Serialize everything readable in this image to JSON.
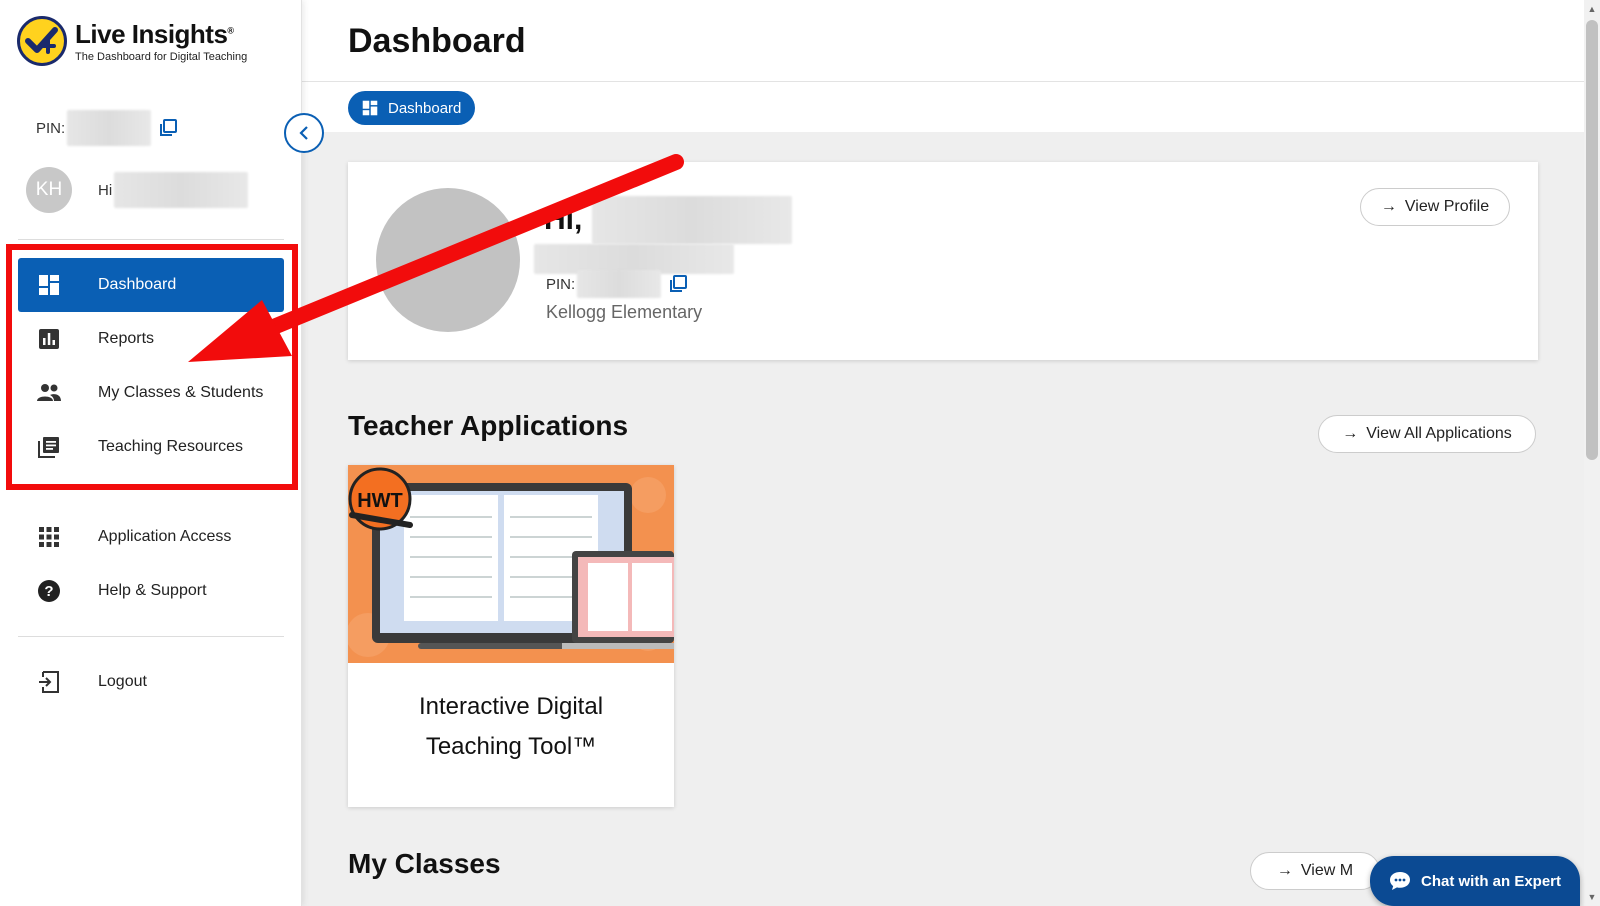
{
  "sidebar": {
    "logo_title": "Live Insights",
    "logo_reg": "®",
    "logo_subtitle": "The Dashboard for Digital Teaching",
    "pin_label": "PIN:",
    "avatar_initials": "KH",
    "greeting": "Hi",
    "nav": [
      {
        "label": "Dashboard",
        "icon": "dashboard-icon",
        "active": true
      },
      {
        "label": "Reports",
        "icon": "bar-chart-icon",
        "active": false
      },
      {
        "label": "My Classes & Students",
        "icon": "people-icon",
        "active": false
      },
      {
        "label": "Teaching Resources",
        "icon": "library-books-icon",
        "active": false
      },
      {
        "label": "Application Access",
        "icon": "apps-grid-icon",
        "active": false
      },
      {
        "label": "Help & Support",
        "icon": "help-icon",
        "active": false
      },
      {
        "label": "Logout",
        "icon": "logout-icon",
        "active": false
      }
    ]
  },
  "header": {
    "title": "Dashboard",
    "breadcrumb": "Dashboard"
  },
  "profile": {
    "greeting": "Hi,",
    "pin_label": "PIN:",
    "school": "Kellogg Elementary",
    "view_profile": "View Profile"
  },
  "teacher_apps": {
    "title": "Teacher Applications",
    "view_all": "View All Applications",
    "apps": [
      {
        "name_line1": "Interactive Digital",
        "name_line2": "Teaching Tool™",
        "badge": "HWT"
      }
    ]
  },
  "my_classes": {
    "title": "My Classes",
    "view_button": "View M"
  },
  "chat": {
    "label": "Chat with an Expert"
  },
  "colors": {
    "primary": "#0a5fb4",
    "highlight": "#f20c0c",
    "chat": "#0b4a93",
    "app_thumb": "#f3914f"
  }
}
